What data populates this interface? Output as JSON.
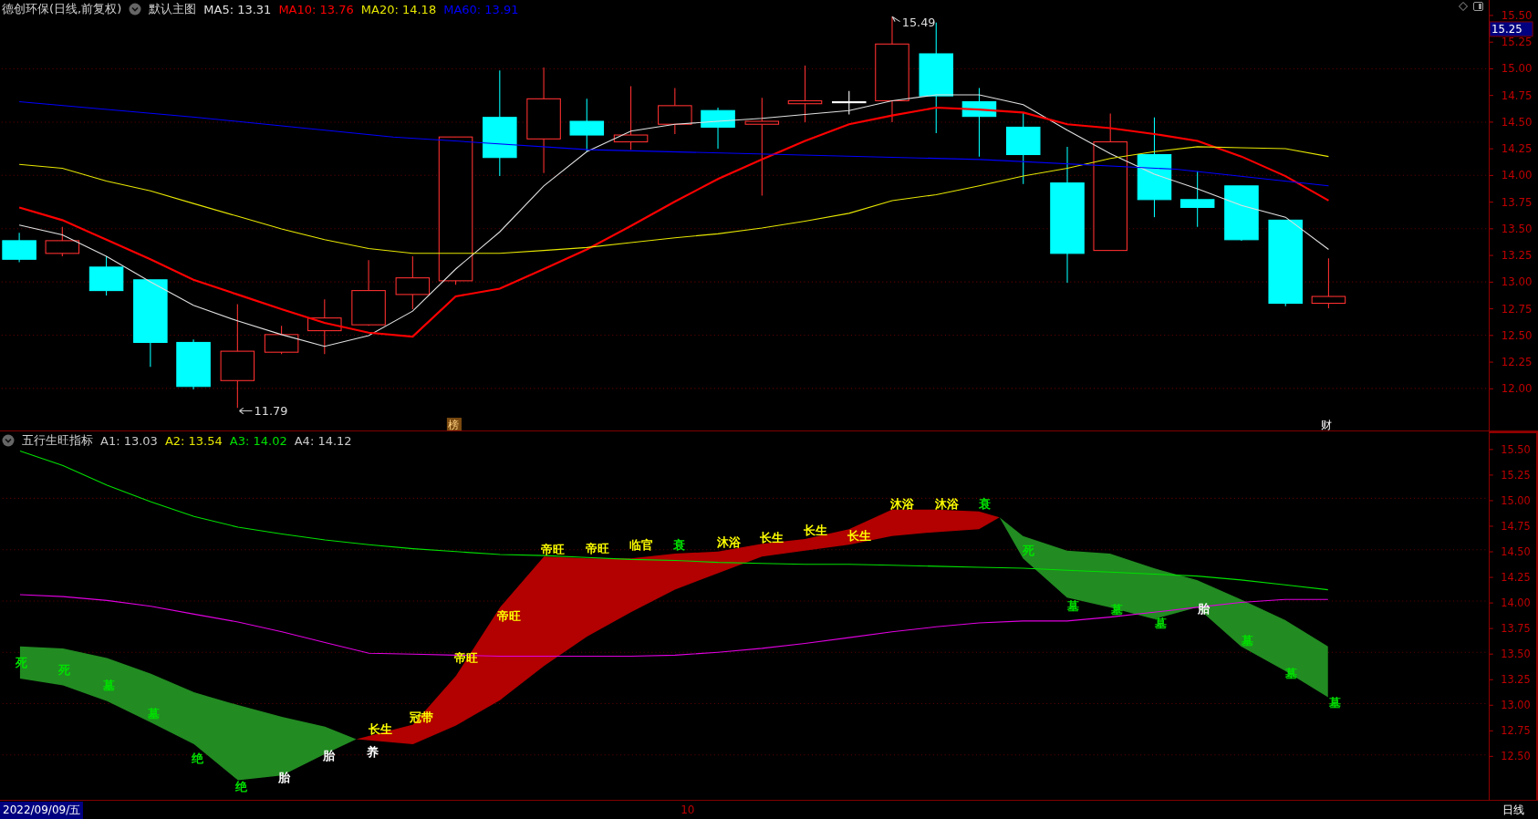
{
  "main_chart": {
    "title": "德创环保(日线,前复权)",
    "template": "默认主图",
    "legend": [
      {
        "text": "MA5: 13.31",
        "color": "#e0e0e0"
      },
      {
        "text": "MA10: 13.76",
        "color": "#ff0000"
      },
      {
        "text": "MA20: 14.18",
        "color": "#e6e600"
      },
      {
        "text": "MA60: 13.91",
        "color": "#0000ff"
      }
    ],
    "high_marker": "15.49",
    "low_marker": "11.79",
    "markers": [
      "榜",
      "财"
    ],
    "current_price": "15.25",
    "y_ticks": [
      "15.50",
      "15.25",
      "15.00",
      "14.75",
      "14.50",
      "14.25",
      "14.00",
      "13.75",
      "13.50",
      "13.25",
      "13.00",
      "12.75",
      "12.50",
      "12.25",
      "12.00"
    ]
  },
  "indicator": {
    "title": "五行生旺指标",
    "legend": [
      {
        "text": "A1: 13.03",
        "color": "#c8c8c8"
      },
      {
        "text": "A2: 13.54",
        "color": "#e6e600"
      },
      {
        "text": "A3: 14.02",
        "color": "#00e000"
      },
      {
        "text": "A4: 14.12",
        "color": "#c8c8c8"
      }
    ],
    "labels": [
      {
        "text": "死",
        "color": "#00e000"
      },
      {
        "text": "死",
        "color": "#00e000"
      },
      {
        "text": "墓",
        "color": "#00e000"
      },
      {
        "text": "墓",
        "color": "#00e000"
      },
      {
        "text": "绝",
        "color": "#00e000"
      },
      {
        "text": "绝",
        "color": "#00e000"
      },
      {
        "text": "胎",
        "color": "#ffffff"
      },
      {
        "text": "胎",
        "color": "#ffffff"
      },
      {
        "text": "养",
        "color": "#ffffff"
      },
      {
        "text": "长生",
        "color": "#ffff00"
      },
      {
        "text": "冠带",
        "color": "#ffff00"
      },
      {
        "text": "帝旺",
        "color": "#ffff00"
      },
      {
        "text": "帝旺",
        "color": "#ffff00"
      },
      {
        "text": "帝旺",
        "color": "#ffff00"
      },
      {
        "text": "帝旺",
        "color": "#ffff00"
      },
      {
        "text": "临官",
        "color": "#ffff00"
      },
      {
        "text": "衰",
        "color": "#00e000"
      },
      {
        "text": "沐浴",
        "color": "#ffff00"
      },
      {
        "text": "长生",
        "color": "#ffff00"
      },
      {
        "text": "长生",
        "color": "#ffff00"
      },
      {
        "text": "长生",
        "color": "#ffff00"
      },
      {
        "text": "沐浴",
        "color": "#ffff00"
      },
      {
        "text": "沐浴",
        "color": "#ffff00"
      },
      {
        "text": "衰",
        "color": "#00e000"
      },
      {
        "text": "死",
        "color": "#00e000"
      },
      {
        "text": "墓",
        "color": "#00e000"
      },
      {
        "text": "墓",
        "color": "#00e000"
      },
      {
        "text": "墓",
        "color": "#00e000"
      },
      {
        "text": "胎",
        "color": "#ffffff"
      },
      {
        "text": "墓",
        "color": "#00e000"
      },
      {
        "text": "墓",
        "color": "#00e000"
      },
      {
        "text": "墓",
        "color": "#00e000"
      }
    ],
    "y_ticks": [
      "15.50",
      "15.25",
      "15.00",
      "14.75",
      "14.50",
      "14.25",
      "14.00",
      "13.75",
      "13.50",
      "13.25",
      "13.00",
      "12.75",
      "12.50"
    ]
  },
  "status_bar": {
    "date": "2022/09/09/五",
    "month_tick": "10",
    "period": "日线"
  }
}
